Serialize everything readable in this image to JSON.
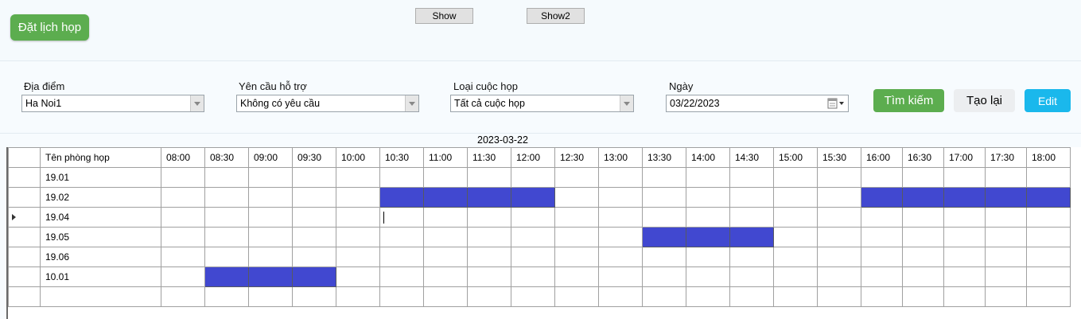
{
  "header": {
    "book_button": "Đặt lịch họp",
    "show_button": "Show",
    "show2_button": "Show2"
  },
  "filters": {
    "location": {
      "label": "Địa điểm",
      "value": "Ha Noi1"
    },
    "support": {
      "label": "Yên cầu hỗ trợ",
      "value": "Không có yêu cầu"
    },
    "meeting_type": {
      "label": "Loại cuộc họp",
      "value": "Tất cả cuộc họp"
    },
    "date": {
      "label": "Ngày",
      "value": "03/22/2023"
    },
    "search_button": "Tìm kiếm",
    "reset_button": "Tạo lại",
    "edit_button": "Edit"
  },
  "schedule": {
    "date_caption": "2023-03-22",
    "room_header": "Tên phòng họp",
    "times": [
      "08:00",
      "08:30",
      "09:00",
      "09:30",
      "10:00",
      "10:30",
      "11:00",
      "11:30",
      "12:00",
      "12:30",
      "13:00",
      "13:30",
      "14:00",
      "14:30",
      "15:00",
      "15:30",
      "16:00",
      "16:30",
      "17:00",
      "17:30",
      "18:00"
    ],
    "rooms": [
      {
        "name": "19.01",
        "booked": []
      },
      {
        "name": "19.02",
        "booked": [
          "10:30",
          "11:00",
          "11:30",
          "12:00",
          "16:00",
          "16:30",
          "17:00",
          "17:30",
          "18:00"
        ]
      },
      {
        "name": "19.04",
        "booked": [],
        "current": true
      },
      {
        "name": "19.05",
        "booked": [
          "13:30",
          "14:00",
          "14:30"
        ]
      },
      {
        "name": "19.06",
        "booked": []
      },
      {
        "name": "10.01",
        "booked": [
          "08:30",
          "09:00",
          "09:30"
        ]
      },
      {
        "name": "",
        "booked": []
      }
    ],
    "colors": {
      "booked": "#4148d0"
    }
  }
}
